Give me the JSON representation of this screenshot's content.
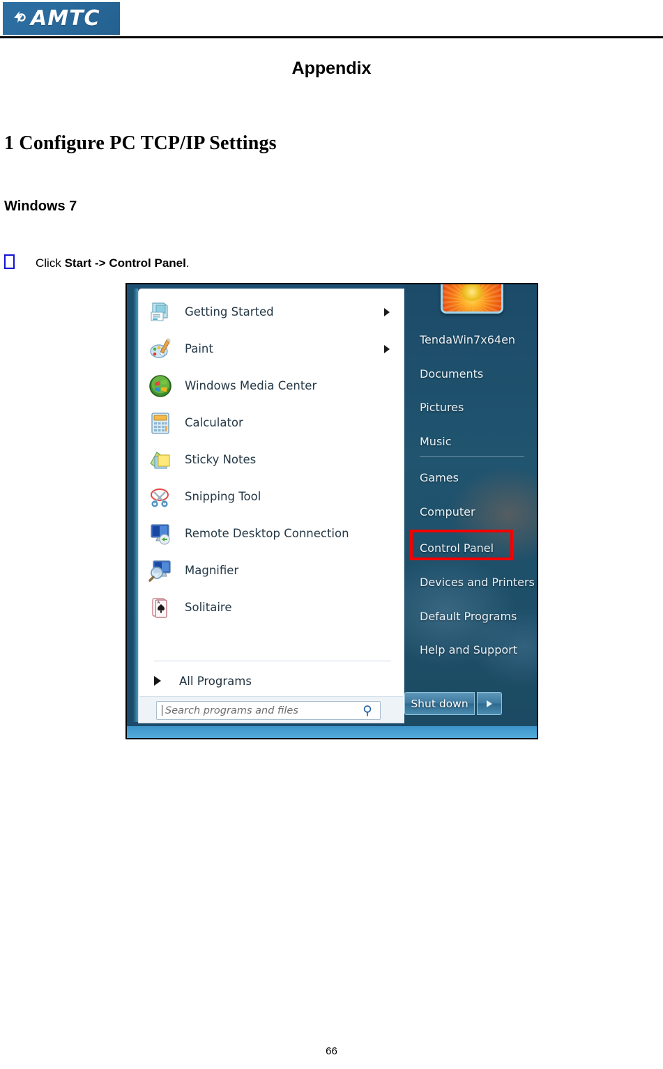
{
  "header": {
    "logo_text": "AMTC",
    "logo_icon": "amtc-logo-mark",
    "brand_color": "#2b6c9f"
  },
  "document": {
    "appendix_title": "Appendix",
    "section_heading": "1 Configure PC TCP/IP Settings",
    "subsection_heading": "Windows 7",
    "step_prefix": "Click ",
    "step_bold": "Start -> Control Panel",
    "step_suffix": ".",
    "page_number": "66"
  },
  "start_menu": {
    "left_items": [
      {
        "label": "Getting Started",
        "icon": "getting-started-icon",
        "has_submenu": true
      },
      {
        "label": "Paint",
        "icon": "paint-icon",
        "has_submenu": true
      },
      {
        "label": "Windows Media Center",
        "icon": "windows-media-center-icon",
        "has_submenu": false
      },
      {
        "label": "Calculator",
        "icon": "calculator-icon",
        "has_submenu": false
      },
      {
        "label": "Sticky Notes",
        "icon": "sticky-notes-icon",
        "has_submenu": false
      },
      {
        "label": "Snipping Tool",
        "icon": "snipping-tool-icon",
        "has_submenu": false
      },
      {
        "label": "Remote Desktop Connection",
        "icon": "remote-desktop-icon",
        "has_submenu": false
      },
      {
        "label": "Magnifier",
        "icon": "magnifier-icon",
        "has_submenu": false
      },
      {
        "label": "Solitaire",
        "icon": "solitaire-icon",
        "has_submenu": false
      }
    ],
    "all_programs_label": "All Programs",
    "search_placeholder": "Search programs and files",
    "search_value": "",
    "search_icon": "search-icon",
    "avatar_icon": "user-avatar-sunflower",
    "right_items": [
      {
        "label": "TendaWin7x64en",
        "highlighted": false
      },
      {
        "label": "Documents",
        "highlighted": false
      },
      {
        "label": "Pictures",
        "highlighted": false
      },
      {
        "label": "Music",
        "highlighted": false
      },
      {
        "label": "Games",
        "highlighted": false
      },
      {
        "label": "Computer",
        "highlighted": false
      },
      {
        "label": "Control Panel",
        "highlighted": true
      },
      {
        "label": "Devices and Printers",
        "highlighted": false
      },
      {
        "label": "Default Programs",
        "highlighted": false
      },
      {
        "label": "Help and Support",
        "highlighted": false
      }
    ],
    "highlight_color": "#f40000",
    "shutdown_label": "Shut down",
    "shutdown_arrow_icon": "chevron-right-icon"
  }
}
